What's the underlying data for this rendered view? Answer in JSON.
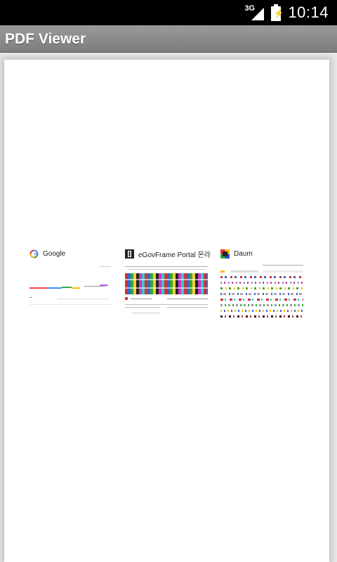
{
  "status_bar": {
    "network": "3G",
    "time": "10:14"
  },
  "app": {
    "title": "PDF Viewer"
  },
  "thumbnails": [
    {
      "label": "Google",
      "icon": "google-icon"
    },
    {
      "label": "eGovFrame Portal 온라",
      "icon": "egov-icon"
    },
    {
      "label": "Daum",
      "icon": "daum-icon"
    }
  ],
  "colors": {
    "statusbar_bg": "#000000",
    "titlebar_bg": "#8c8c8c",
    "page_bg": "#ffffff"
  }
}
